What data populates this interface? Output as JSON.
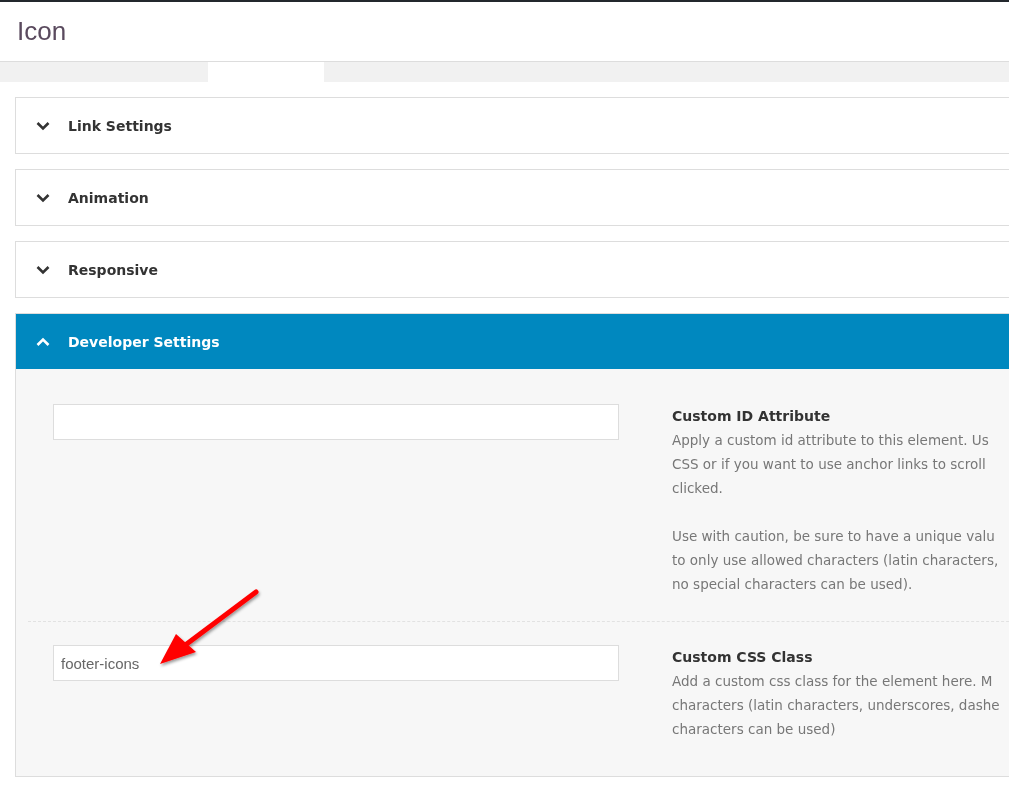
{
  "window": {
    "title": "Icon"
  },
  "sections": [
    {
      "title": "Link Settings",
      "expanded": false
    },
    {
      "title": "Animation",
      "expanded": false
    },
    {
      "title": "Responsive",
      "expanded": false
    },
    {
      "title": "Developer Settings",
      "expanded": true
    }
  ],
  "fields": [
    {
      "label": "Custom ID Attribute",
      "paragraphs": [
        [
          "Apply a custom id attribute to this element. Us",
          "CSS or if you want to use anchor links to scroll",
          "clicked."
        ],
        [
          "Use with caution, be sure to have a unique valu",
          "to only use allowed characters (latin characters,",
          "no special characters can be used)."
        ]
      ]
    },
    {
      "label": "Custom CSS Class",
      "value": "footer-icons",
      "paragraphs": [
        [
          "Add a custom css class for the element here. M",
          "characters (latin characters, underscores, dashe",
          "characters can be used)"
        ]
      ]
    }
  ]
}
